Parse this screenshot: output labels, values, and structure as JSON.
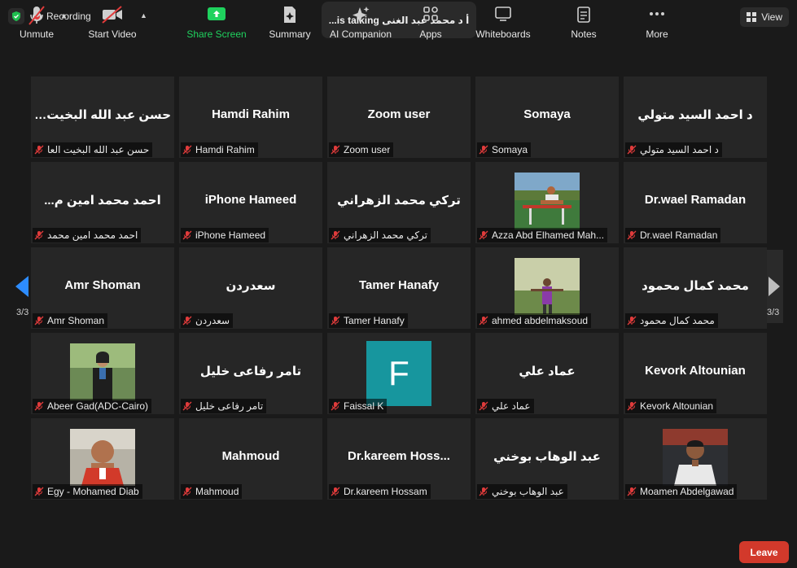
{
  "header": {
    "recording_label": "Recording",
    "talking_text": "أ د محمد عبد الغنى is  talking...",
    "view_label": "View"
  },
  "nav": {
    "page_left": "3/3",
    "page_right": "3/3"
  },
  "tiles": [
    {
      "name": "حسن عبد الله البخيت العا...",
      "label": "حسن عبد الله البخيت العا"
    },
    {
      "name": "Hamdi Rahim",
      "label": "Hamdi Rahim"
    },
    {
      "name": "Zoom user",
      "label": "Zoom user"
    },
    {
      "name": "Somaya",
      "label": "Somaya"
    },
    {
      "name": "د احمد السيد متولي",
      "label": "د احمد السيد متولي"
    },
    {
      "name": "احمد محمد امين م...",
      "label": "احمد محمد امين محمد"
    },
    {
      "name": "iPhone  Hameed",
      "label": "iPhone Hameed"
    },
    {
      "name": "تركي محمد الزهراني",
      "label": "تركي محمد الزهراني"
    },
    {
      "name": "",
      "label": "Azza Abd Elhamed Mah..."
    },
    {
      "name": "Dr.wael Ramadan",
      "label": "Dr.wael Ramadan"
    },
    {
      "name": "Amr Shoman",
      "label": "Amr Shoman"
    },
    {
      "name": "سعدردن",
      "label": "سعدردن"
    },
    {
      "name": "Tamer Hanafy",
      "label": "Tamer Hanafy"
    },
    {
      "name": "",
      "label": "ahmed abdelmaksoud"
    },
    {
      "name": "محمد كمال محمود",
      "label": "محمد كمال محمود"
    },
    {
      "name": "",
      "label": "Abeer Gad(ADC-Cairo)"
    },
    {
      "name": "تامر رفاعى خليل",
      "label": "تامر رفاعى خليل"
    },
    {
      "name": "",
      "label": "Faissal K",
      "avatar_letter": "F"
    },
    {
      "name": "عماد علي",
      "label": "عماد علي"
    },
    {
      "name": "Kevork Altounian",
      "label": "Kevork Altounian"
    },
    {
      "name": "",
      "label": "Egy - Mohamed Diab"
    },
    {
      "name": "Mahmoud",
      "label": "Mahmoud"
    },
    {
      "name": "Dr.kareem  Hoss...",
      "label": "Dr.kareem Hossam"
    },
    {
      "name": "عبد الوهاب بوخني",
      "label": "عبد الوهاب بوخني"
    },
    {
      "name": "",
      "label": "Moamen Abdelgawad"
    }
  ],
  "toolbar": {
    "unmute": "Unmute",
    "start_video": "Start Video",
    "share_screen": "Share Screen",
    "summary": "Summary",
    "ai_companion": "AI Companion",
    "apps": "Apps",
    "whiteboards": "Whiteboards",
    "notes": "Notes",
    "more": "More",
    "leave": "Leave"
  },
  "colors": {
    "leave": "#d2392b",
    "share": "#1fd25e",
    "avatar_teal": "#17969e",
    "shield": "#1fbf4f"
  }
}
